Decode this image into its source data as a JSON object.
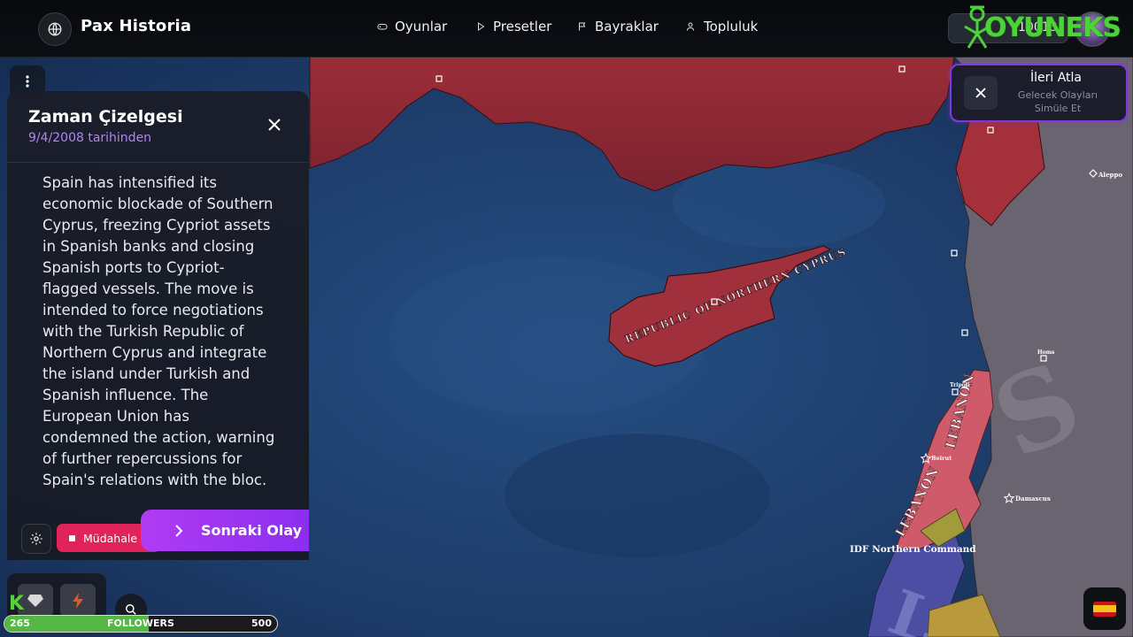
{
  "app": {
    "title": "Pax Historia",
    "watermark": "OYUNEKS"
  },
  "nav": {
    "items": [
      {
        "label": "Oyunlar",
        "icon": "gamepad-icon"
      },
      {
        "label": "Presetler",
        "icon": "play-icon"
      },
      {
        "label": "Bayraklar",
        "icon": "flag-icon"
      },
      {
        "label": "Topluluk",
        "icon": "users-icon"
      }
    ]
  },
  "account": {
    "coins": "10013"
  },
  "timeline": {
    "title": "Zaman Çizelgesi",
    "subtitle": "9/4/2008 tarihinden",
    "event_text": "Spain has intensified its economic blockade of Southern Cyprus, freezing Cypriot assets in Spanish banks and closing Spanish ports to Cypriot-flagged vessels. The move is intended to force negotiations with the Turkish Republic of Northern Cyprus and integrate the island under Turkish and Spanish influence. The European Union has condemned the action, warning of further repercussions for Spain's relations with the bloc.",
    "intervene_label": "Müdahale Et",
    "next_label": "Sonraki Olay"
  },
  "skip_ahead": {
    "title": "İleri Atla",
    "subtitle_line1": "Gelecek Olayları",
    "subtitle_line2": "Simüle Et"
  },
  "map": {
    "labels": {
      "cyprus": "REPUBLIC OF NORTHERN CYPRUS",
      "lebanon_north": "LEBANON",
      "lebanon_south": "LEBANON",
      "idf": "IDF Northern Command",
      "aleppo": "Aleppo",
      "beirut": "Beirut",
      "damascus": "Damascus",
      "tripoli": "Tripoli",
      "homs": "Homs"
    }
  },
  "followers": {
    "current": "265",
    "label": "FOLLOWERS",
    "goal": "500",
    "progress": 0.53
  },
  "colors": {
    "accent_purple": "#9b34f0",
    "intervene_pink": "#e2225a",
    "territory_red": "#a8313d",
    "sea_blue": "#1f3f6d"
  }
}
